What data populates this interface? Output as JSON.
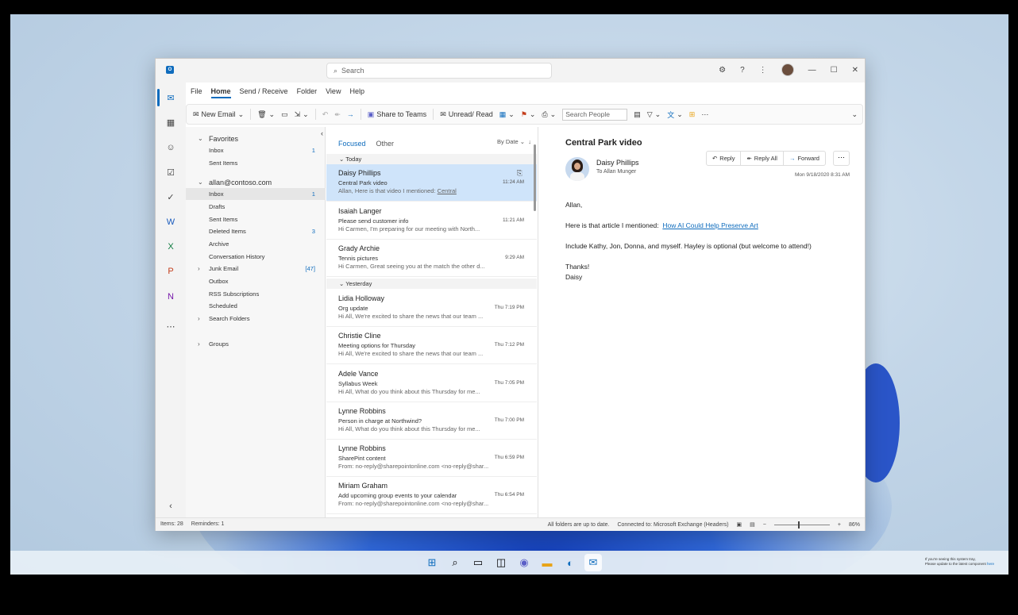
{
  "titlebar": {
    "search_placeholder": "Search"
  },
  "menu": [
    "File",
    "Home",
    "Send / Receive",
    "Folder",
    "View",
    "Help"
  ],
  "menu_selected": "Home",
  "ribbon": {
    "new_email": "New Email",
    "share_teams": "Share to Teams",
    "unread_read": "Unread/ Read",
    "search_people_placeholder": "Search People"
  },
  "folders": {
    "favorites": "Favorites",
    "fav_inbox": "Inbox",
    "fav_inbox_count": "1",
    "fav_sent": "Sent Items",
    "account": "allan@contoso.com",
    "items": [
      {
        "label": "Inbox",
        "count": "1"
      },
      {
        "label": "Drafts",
        "count": ""
      },
      {
        "label": "Sent Items",
        "count": ""
      },
      {
        "label": "Deleted Items",
        "count": "3"
      },
      {
        "label": "Archive",
        "count": ""
      },
      {
        "label": "Conversation History",
        "count": ""
      },
      {
        "label": "Junk Email",
        "count": "[47]"
      },
      {
        "label": "Outbox",
        "count": ""
      },
      {
        "label": "RSS Subscriptions",
        "count": ""
      },
      {
        "label": "Scheduled",
        "count": ""
      },
      {
        "label": "Search Folders",
        "count": ""
      }
    ],
    "groups": "Groups"
  },
  "list": {
    "tab_focused": "Focused",
    "tab_other": "Other",
    "sort": "By Date",
    "today": "Today",
    "yesterday": "Yesterday",
    "messages": [
      {
        "from": "Daisy Phillips",
        "subject": "Central Park video",
        "preview": "Allan, Here is that video I mentioned:",
        "preview_link": "Central",
        "time": "11:24 AM"
      },
      {
        "from": "Isaiah Langer",
        "subject": "Please send customer info",
        "preview": "Hi Carmen, I'm preparing for our meeting with North...",
        "time": "11:21 AM"
      },
      {
        "from": "Grady Archie",
        "subject": "Tennis pictures",
        "preview": "Hi Carmen, Great seeing you at the match the other d...",
        "time": "9:29 AM"
      },
      {
        "from": "Lidia Holloway",
        "subject": "Org update",
        "preview": "Hi All, We're excited to share the news that our team ...",
        "time": "Thu 7:19 PM"
      },
      {
        "from": "Christie Cline",
        "subject": "Meeting options for Thursday",
        "preview": "Hi All, We're excited to share the news that our team ...",
        "time": "Thu 7:12 PM"
      },
      {
        "from": "Adele Vance",
        "subject": "Syllabus Week",
        "preview": "Hi All, What do you think about this Thursday for me...",
        "time": "Thu 7:05 PM"
      },
      {
        "from": "Lynne Robbins",
        "subject": "Person in charge at Northwind?",
        "preview": "Hi All, What do you think about this Thursday for me...",
        "time": "Thu 7:00 PM"
      },
      {
        "from": "Lynne Robbins",
        "subject": "SharePint content",
        "preview": "From: no-reply@sharepointonline.com <no-reply@shar...",
        "time": "Thu 6:59 PM"
      },
      {
        "from": "Miriam Graham",
        "subject": "Add upcoming group events to your calendar",
        "preview": "From: no-reply@sharepointonline.com <no-reply@shar...",
        "time": "Thu 6:54 PM"
      }
    ]
  },
  "reading": {
    "subject": "Central Park video",
    "sender": "Daisy Phillips",
    "to_label": "To",
    "to": "Allan Munger",
    "reply": "Reply",
    "reply_all": "Reply All",
    "forward": "Forward",
    "date": "Mon 9/18/2020 8:31 AM",
    "greeting": "Allan,",
    "line1": "Here is that article I mentioned:",
    "link": "How AI Could Help Preserve Art",
    "line2": "Include Kathy, Jon, Donna, and myself. Hayley is optional (but welcome to attend!)",
    "thanks": "Thanks!",
    "signature": "Daisy"
  },
  "status": {
    "items": "Items: 28",
    "reminders": "Reminders: 1",
    "uptodate": "All folders are up to date.",
    "connected": "Connected to: Microsoft Exchange (Headers)",
    "zoom": "86%"
  },
  "tray": {
    "line1": "If you're seeing this system tray,",
    "line2": "Please update to the latest component",
    "link": "here"
  },
  "colors": {
    "accent": "#0f6cbd",
    "selected_row": "#cfe4fa"
  }
}
